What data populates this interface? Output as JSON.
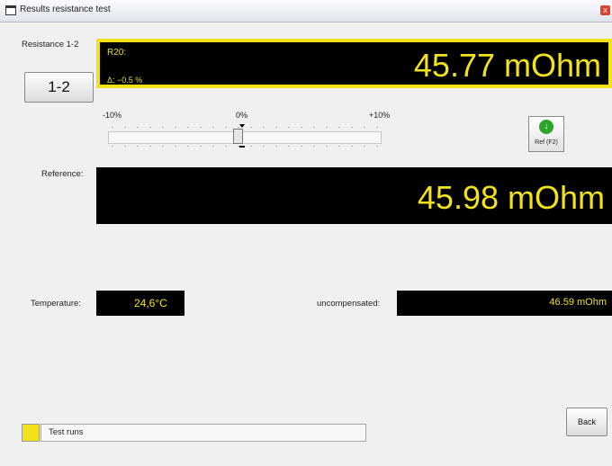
{
  "window": {
    "title": "Results resistance test",
    "close_glyph": "x"
  },
  "resistance": {
    "label": "Resistance 1-2",
    "button_label": "1-2"
  },
  "main_display": {
    "r20_label": "R20:",
    "delta_text": "Δ: −0.5 %",
    "value": "45.77 mOhm"
  },
  "scale": {
    "minus": "-10%",
    "zero": "0%",
    "plus": "+10%",
    "slider_deviation_percent": -0.5
  },
  "ref_button": {
    "label": "Ref (F2)",
    "icon": "arrow-down-icon"
  },
  "reference": {
    "label": "Reference:",
    "value": "45.98 mOhm"
  },
  "temperature": {
    "label": "Temperature:",
    "value": "24,6°C"
  },
  "uncompensated": {
    "label": "uncompensated:",
    "value": "46.59 mOhm"
  },
  "status": {
    "text": "Test runs",
    "indicator_color": "#f2e21a"
  },
  "back": {
    "label": "Back"
  },
  "colors": {
    "display_bg": "#000000",
    "display_text": "#f2e21a",
    "frame": "#f2e21a"
  }
}
